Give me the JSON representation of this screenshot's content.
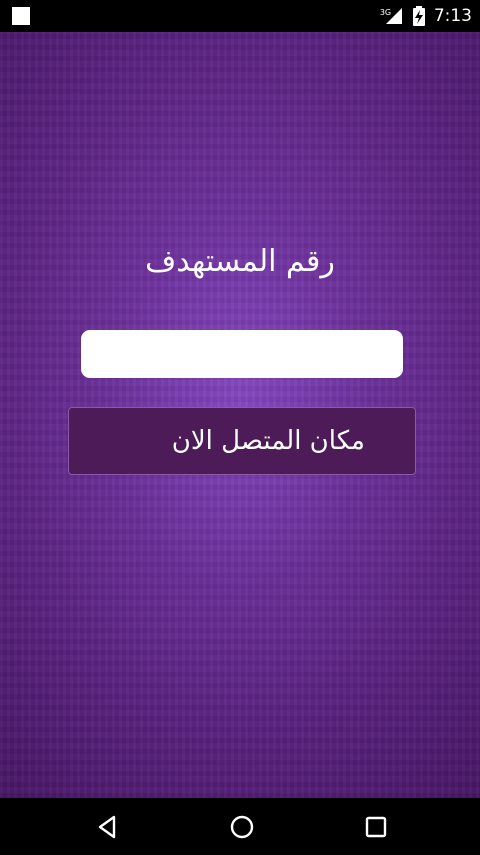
{
  "status_bar": {
    "network_type": "3G",
    "time": "7:13",
    "icons": [
      "notification-icon",
      "signal-icon",
      "battery-charging-icon"
    ]
  },
  "main": {
    "target_label": "رقم المستهدف",
    "number_input": {
      "value": "",
      "placeholder": ""
    },
    "locate_button_label": "مكان المتصل الان"
  },
  "nav_bar": {
    "icons": [
      "back-icon",
      "home-icon",
      "recents-icon"
    ]
  },
  "colors": {
    "background_purple": "#5a2280",
    "button_bg": "#4c1b58",
    "button_border": "#8a5aa6",
    "input_bg": "#ffffff"
  }
}
